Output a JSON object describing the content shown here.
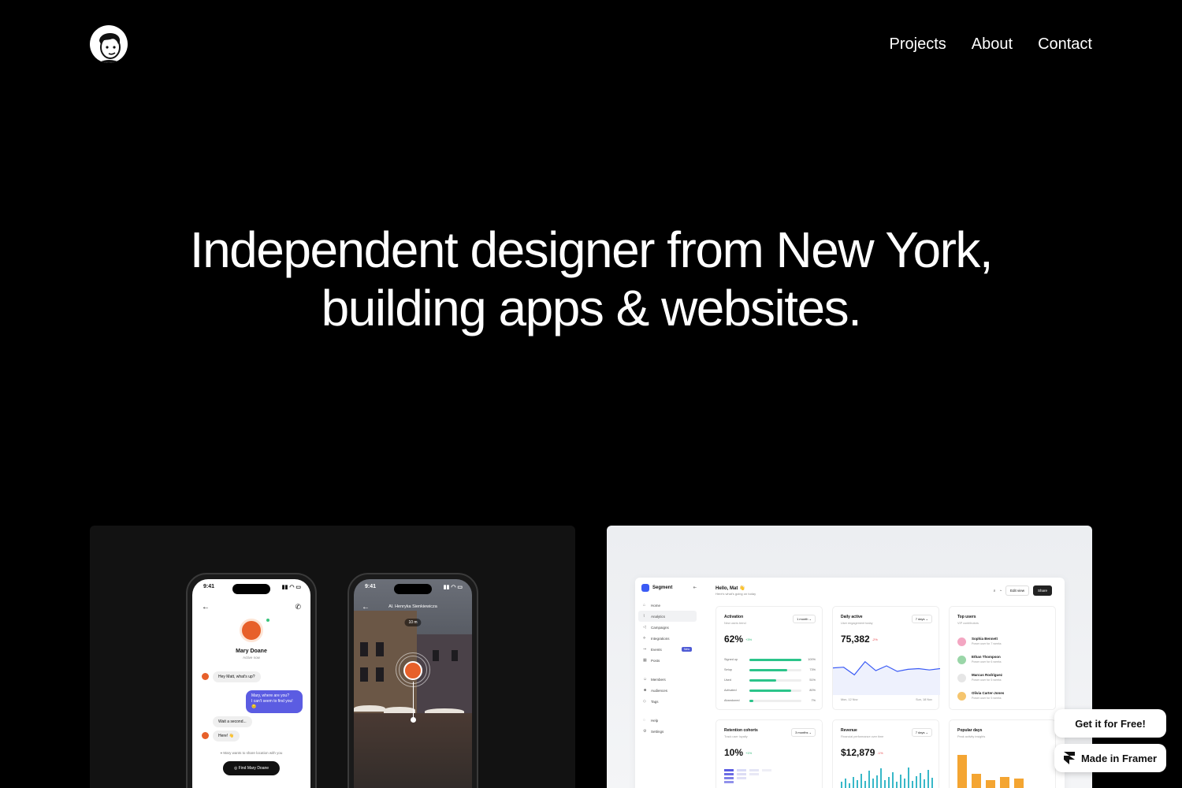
{
  "nav": {
    "projects": "Projects",
    "about": "About",
    "contact": "Contact"
  },
  "hero": {
    "line1": "Independent designer from New York,",
    "line2": "building apps & websites."
  },
  "phone_chat": {
    "time": "9:41",
    "name": "Mary Doane",
    "status": "Active now",
    "messages": [
      {
        "from": "in",
        "text": "Hey Matt, what's up?"
      },
      {
        "from": "out",
        "text": "Mary, where are you?"
      },
      {
        "from": "out",
        "text": "I can't seem to find you! 😔"
      },
      {
        "from": "in",
        "text": "Wait a second..."
      },
      {
        "from": "in",
        "text": "Here! 👋"
      }
    ],
    "share_note": "Mary wants to share location with you",
    "find_button": "Find Mary Doane"
  },
  "phone_map": {
    "time": "9:41",
    "title": "Al. Henryka Sienkiewicza",
    "distance": "10 m"
  },
  "dashboard": {
    "brand": "Segment",
    "sidebar": [
      "Home",
      "Analytics",
      "Campaigns",
      "Integrations",
      "Events",
      "Posts",
      "Members",
      "Audiences",
      "Tags",
      "Help",
      "Settings"
    ],
    "new_badge": "New",
    "greeting": "Hello, Mat 👋",
    "greeting_sub": "Here's what's going on today",
    "edit_view": "Edit view",
    "share": "Share",
    "activation": {
      "title": "Activation",
      "sub": "New users trend",
      "period": "1 month",
      "value": "62%",
      "delta": "+3%",
      "rows": [
        {
          "label": "Signed up",
          "value": "100%",
          "pct": 100
        },
        {
          "label": "Setup",
          "value": "73%",
          "pct": 73
        },
        {
          "label": "Used",
          "value": "51%",
          "pct": 51
        },
        {
          "label": "Activated",
          "value": "80%",
          "pct": 80
        },
        {
          "label": "Abandoned",
          "value": "7%",
          "pct": 7
        }
      ]
    },
    "daily": {
      "title": "Daily active",
      "sub": "User engagement today",
      "period": "7 days",
      "value": "75,382",
      "delta": "-2%",
      "start": "Mon, 12 Nov",
      "end": "Sun, 18 Nov",
      "series": [
        60,
        62,
        40,
        78,
        52,
        66,
        50,
        56,
        58,
        54,
        58
      ]
    },
    "top_users": {
      "title": "Top users",
      "sub": "VIP contributors",
      "users": [
        {
          "name": "Sophia Bennett",
          "desc": "Power user for 7 weeks",
          "color": "#f3a6c2"
        },
        {
          "name": "Ethan Thompson",
          "desc": "Power user for 6 weeks",
          "color": "#9ad6a8"
        },
        {
          "name": "Marcus Rodriguez",
          "desc": "Power user for 5 weeks",
          "color": "#e6e6e6"
        },
        {
          "name": "Olivia Carter-Jones",
          "desc": "Power user for 5 weeks",
          "color": "#f5c56e"
        }
      ]
    },
    "retention": {
      "title": "Retention cohorts",
      "sub": "Track user loyalty",
      "period": "3 months",
      "value": "10%",
      "delta": "+1%"
    },
    "revenue": {
      "title": "Revenue",
      "sub": "Financial performance over time",
      "period": "7 days",
      "value": "$12,879",
      "delta": "-1%"
    },
    "popular": {
      "title": "Popular days",
      "sub": "Peak activity insights"
    }
  },
  "framer": {
    "get_free": "Get it for Free!",
    "made_in": "Made in Framer"
  },
  "colors": {
    "accent_green": "#2bc48a",
    "accent_blue": "#3b5bf5",
    "chat_purple": "#5b5ce2"
  }
}
